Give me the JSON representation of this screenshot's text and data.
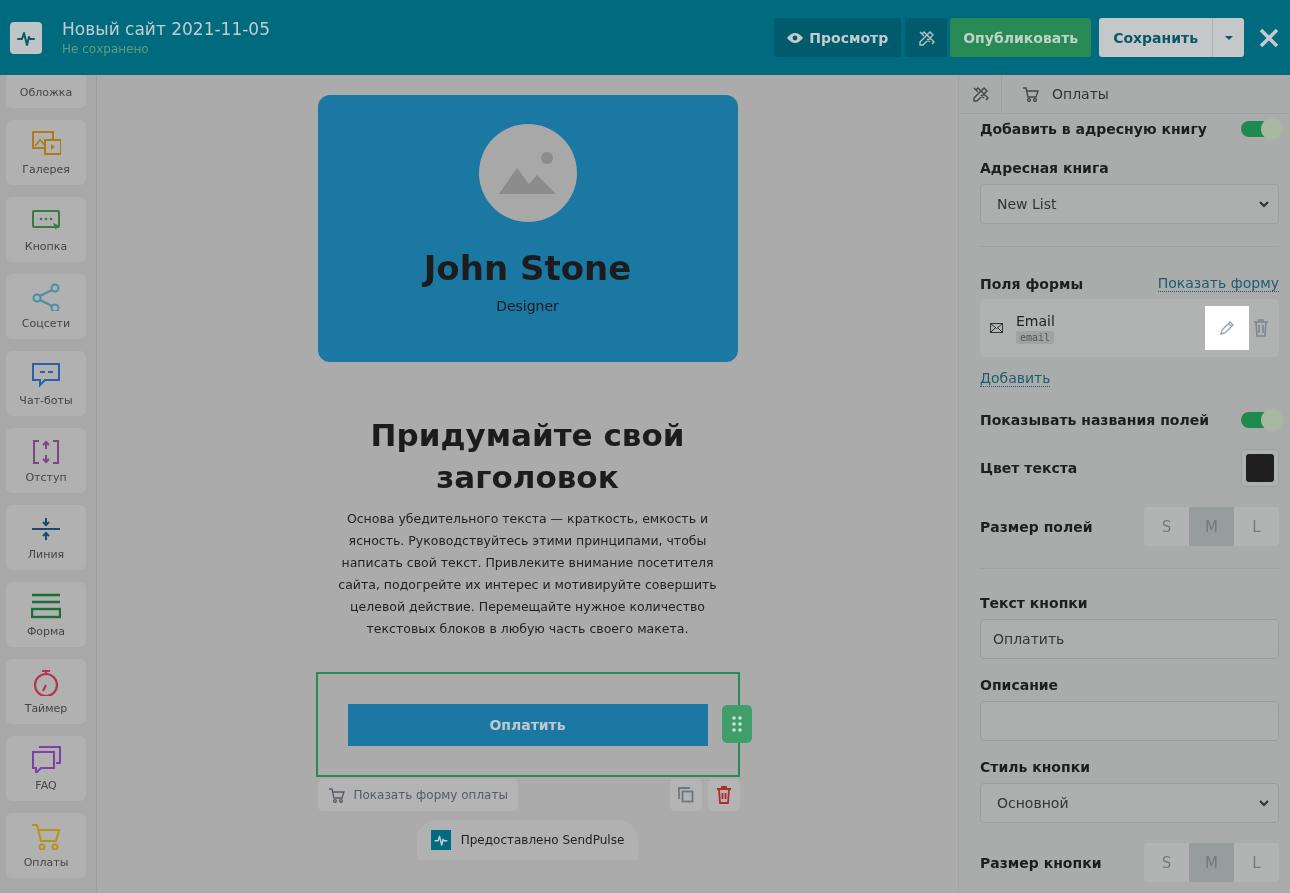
{
  "header": {
    "title": "Новый сайт 2021-11-05",
    "status": "Не сохранено",
    "preview": "Просмотр",
    "publish": "Опубликовать",
    "save": "Сохранить"
  },
  "sidebar": {
    "items": [
      {
        "label": "Обложка"
      },
      {
        "label": "Галерея"
      },
      {
        "label": "Кнопка"
      },
      {
        "label": "Соцсети"
      },
      {
        "label": "Чат-боты"
      },
      {
        "label": "Отступ"
      },
      {
        "label": "Линия"
      },
      {
        "label": "Форма"
      },
      {
        "label": "Таймер"
      },
      {
        "label": "FAQ"
      },
      {
        "label": "Оплаты"
      }
    ]
  },
  "canvas": {
    "profile": {
      "name": "John Stone",
      "role": "Designer"
    },
    "heading": "Придумайте свой заголовок",
    "paragraph": "Основа убедительного текста — краткость, емкость и ясность. Руководствуйтесь этими принципами, чтобы написать свой текст. Привлеките внимание посетителя сайта, подогрейте их интерес и мотивируйте совершить целевой действие. Перемещайте нужное количество текстовых блоков в любую часть своего макета.",
    "pay_button": "Оплатить",
    "show_form": "Показать форму оплаты",
    "credit": "Предоставлено SendPulse"
  },
  "panel": {
    "breadcrumb": "Оплаты",
    "rows": [
      {
        "kind": "toggle",
        "label": "Добавить в адресную книгу",
        "on": true
      },
      {
        "kind": "select",
        "label": "Адресная книга",
        "value": "New List"
      },
      {
        "kind": "divider"
      },
      {
        "kind": "fields",
        "label": "Поля формы",
        "link": "Показать форму",
        "items": [
          {
            "name": "Email",
            "key": "email"
          }
        ],
        "add": "Добавить"
      },
      {
        "kind": "toggle",
        "label": "Показывать названия полей",
        "on": true
      },
      {
        "kind": "color",
        "label": "Цвет текста",
        "color": "#1e1e1e"
      },
      {
        "kind": "size",
        "label": "Размер полей",
        "options": [
          {
            "label": "S",
            "selected": false
          },
          {
            "label": "M",
            "selected": true
          },
          {
            "label": "L",
            "selected": false
          }
        ]
      },
      {
        "kind": "divider"
      },
      {
        "kind": "input",
        "label": "Текст кнопки",
        "value": "Оплатить"
      },
      {
        "kind": "input",
        "label": "Описание"
      },
      {
        "kind": "select",
        "label": "Стиль кнопки",
        "value": "Основной"
      },
      {
        "kind": "size",
        "label": "Размер кнопки",
        "options": [
          {
            "label": "S",
            "selected": false
          },
          {
            "label": "M",
            "selected": true
          },
          {
            "label": "L",
            "selected": false
          }
        ]
      }
    ]
  }
}
